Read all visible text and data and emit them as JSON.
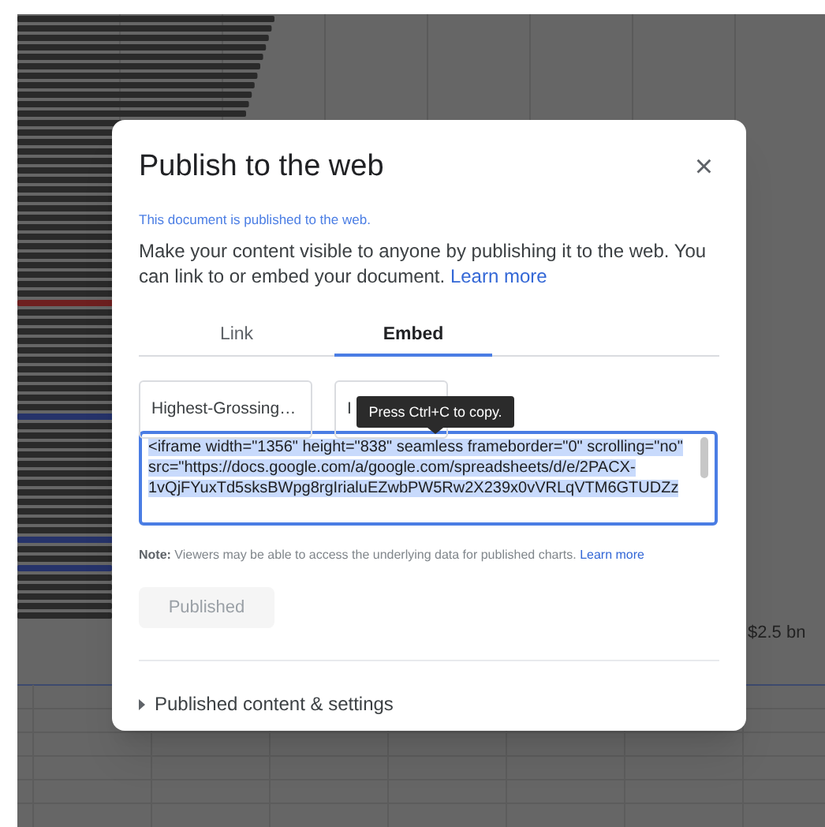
{
  "background": {
    "axis_label": "$2.5 bn"
  },
  "dialog": {
    "title": "Publish to the web",
    "close": "×",
    "status": "This document is published to the web.",
    "description": "Make your content visible to anyone by publishing it to the web. You can link to or embed your document.",
    "description_link": "Learn more",
    "tabs": [
      {
        "label": "Link",
        "selected": false
      },
      {
        "label": "Embed",
        "selected": true
      }
    ],
    "dropdowns": [
      {
        "value": "Highest-Grossing…"
      },
      {
        "value": "I"
      }
    ],
    "tooltip": "Press Ctrl+C to copy.",
    "embed_code": "<iframe width=\"1356\" height=\"838\" seamless frameborder=\"0\" scrolling=\"no\" src=\"https://docs.google.com/a/google.com/spreadsheets/d/e/2PACX-1vQjFYuxTd5sksBWpg8rgIrialuEZwbPW5Rw2X239x0vVRLqVTM6GTUDZz",
    "note_label": "Note:",
    "note": "Viewers may be able to access the underlying data for published charts.",
    "note_link": "Learn more",
    "publish_button": {
      "label": "Published",
      "disabled": true
    },
    "section": {
      "label": "Published content & settings",
      "expanded": false
    }
  }
}
